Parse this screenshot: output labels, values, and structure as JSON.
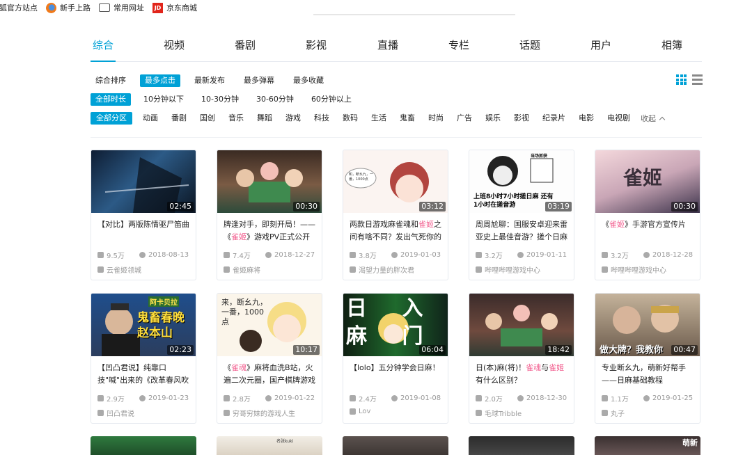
{
  "bookmarks": [
    {
      "label": "狐官方站点",
      "icon": "fox-icon"
    },
    {
      "label": "新手上路",
      "icon": "firefox-icon"
    },
    {
      "label": "常用网址",
      "icon": "folder-icon"
    },
    {
      "label": "京东商城",
      "icon": "jd-icon",
      "icon_text": "JD"
    }
  ],
  "main_tabs": [
    "综合",
    "视频",
    "番剧",
    "影视",
    "直播",
    "专栏",
    "话题",
    "用户",
    "相簿"
  ],
  "sort_filters": [
    "综合排序",
    "最多点击",
    "最新发布",
    "最多弹幕",
    "最多收藏"
  ],
  "duration_filters": [
    "全部时长",
    "10分钟以下",
    "10-30分钟",
    "30-60分钟",
    "60分钟以上"
  ],
  "zone_filters": [
    "全部分区",
    "动画",
    "番剧",
    "国创",
    "音乐",
    "舞蹈",
    "游戏",
    "科技",
    "数码",
    "生活",
    "鬼畜",
    "时尚",
    "广告",
    "娱乐",
    "影视",
    "纪录片",
    "电影",
    "电视剧"
  ],
  "collapse_label": "收起",
  "active": {
    "main_tab": "综合",
    "sort": "最多点击",
    "duration": "全部时长",
    "zone": "全部分区"
  },
  "accent_color": "#00a1d6",
  "highlight_color": "#f25d8e",
  "videos": [
    {
      "title_parts": [
        "【对比】两版陈情驱尸笛曲"
      ],
      "hl": [
        false
      ],
      "duration": "02:45",
      "views": "9.5万",
      "date": "2018-08-13",
      "uploader": "云雀姬领城"
    },
    {
      "title_parts": [
        "牌逢对手，即刻开局！——《",
        "雀姬",
        "》游戏PV正式公开"
      ],
      "hl": [
        false,
        true,
        false
      ],
      "duration": "00:30",
      "views": "7.4万",
      "date": "2018-12-27",
      "uploader": "雀姬麻将"
    },
    {
      "title_parts": [
        "两款日游戏麻雀魂和",
        "雀姬",
        "之间有啥不同？发出气死你的"
      ],
      "hl": [
        false,
        true,
        false
      ],
      "duration": "03:12",
      "views": "3.8万",
      "date": "2019-01-03",
      "uploader": "渴望力量的胖次君",
      "thumb_text": "和，断幺九，一番，1000点"
    },
    {
      "title_parts": [
        "周周尬聊：国服安卓迎来雷亚史上最佳音游？搓个日麻"
      ],
      "hl": [
        false
      ],
      "duration": "03:19",
      "views": "3.2万",
      "date": "2019-01-11",
      "uploader": "哔哩哔哩游戏中心",
      "thumb_text": "上班8小时7小时搓日麻 还有1小时在搓音游",
      "thumb_label": "当场抓获"
    },
    {
      "title_parts": [
        "《",
        "雀姬",
        "》手游官方宣传片"
      ],
      "hl": [
        false,
        true,
        false
      ],
      "duration": "00:30",
      "views": "3.2万",
      "date": "2018-12-28",
      "uploader": "哔哩哔哩游戏中心",
      "thumb_text": "雀姬"
    },
    {
      "title_parts": [
        "【凹凸君说】纯靠口技\"喊\"出来的《改革春风吹满地》"
      ],
      "hl": [
        false
      ],
      "duration": "02:23",
      "views": "2.9万",
      "date": "2019-01-23",
      "uploader": "凹凸君说",
      "thumb_text": "鬼畜春晚 赵本山",
      "thumb_label": "阿卡贝拉"
    },
    {
      "title_parts": [
        "《",
        "雀魂",
        "》麻将血洗B站，火遍二次元圈，国产棋牌游戏"
      ],
      "hl": [
        false,
        true,
        false
      ],
      "duration": "10:17",
      "views": "2.8万",
      "date": "2019-01-22",
      "uploader": "穷哥穷妹的游戏人生",
      "thumb_text": "来，断幺九，一番，1000点"
    },
    {
      "title_parts": [
        "【lolo】五分钟学会日麻！"
      ],
      "hl": [
        false
      ],
      "duration": "06:04",
      "views": "2.4万",
      "date": "2019-01-08",
      "uploader": "Lov",
      "thumb_text": "日 入 麻 门"
    },
    {
      "title_parts": [
        "日(本)麻(将)！",
        "雀魂",
        "与",
        "雀姬",
        "有什么区别？"
      ],
      "hl": [
        false,
        true,
        false,
        true,
        false
      ],
      "duration": "18:42",
      "views": "2.0万",
      "date": "2018-12-30",
      "uploader": "毛球Tribble"
    },
    {
      "title_parts": [
        "专业断幺九，萌新好帮手——日麻基础教程"
      ],
      "hl": [
        false
      ],
      "duration": "00:47",
      "views": "1.1万",
      "date": "2019-01-25",
      "uploader": "丸子",
      "thumb_text": "做大牌？我教你"
    }
  ],
  "partial_thumb_texts": [
    "",
    "名张kuki",
    "",
    "",
    "萌新"
  ]
}
